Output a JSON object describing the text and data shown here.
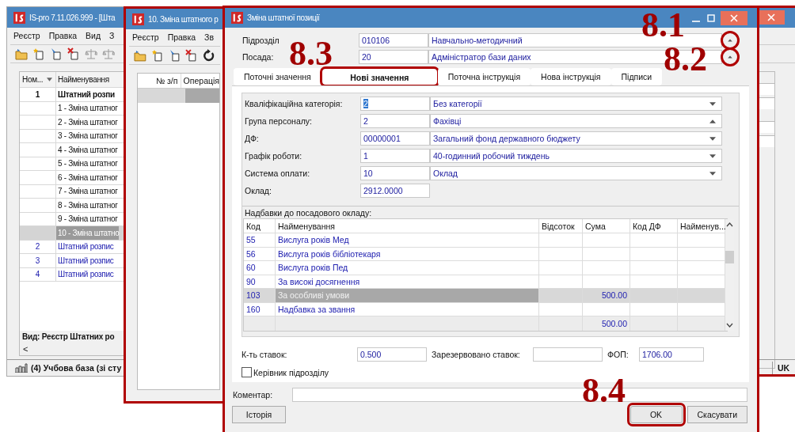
{
  "main_window": {
    "title": "IS-pro 7.11.026.999 - [Шта",
    "menu": [
      "Реєстр",
      "Правка",
      "Вид",
      "З"
    ],
    "toolbar": [
      {
        "kind": "folder"
      },
      {
        "kind": "new"
      },
      {
        "kind": "edit"
      },
      {
        "kind": "delete"
      },
      {
        "kind": "scales"
      },
      {
        "kind": "scales"
      }
    ],
    "table": {
      "columns": [
        "Ном...",
        "Найменування"
      ],
      "rows": [
        {
          "number": "1",
          "name": "Штатний розпи",
          "expanded": true,
          "children": [
            {
              "name": "1 - Зміна штатног",
              "selected": false
            },
            {
              "name": "2 - Зміна штатног",
              "selected": false
            },
            {
              "name": "3 - Зміна штатног",
              "selected": false
            },
            {
              "name": "4 - Зміна штатног",
              "selected": false
            },
            {
              "name": "5 - Зміна штатног",
              "selected": false
            },
            {
              "name": "6 - Зміна штатног",
              "selected": false
            },
            {
              "name": "7 - Зміна штатног",
              "selected": false
            },
            {
              "name": "8 - Зміна штатног",
              "selected": false
            },
            {
              "name": "9 - Зміна штатног",
              "selected": false
            },
            {
              "name": "10 - Зміна штатно",
              "selected": true
            }
          ]
        },
        {
          "number": "2",
          "name": "Штатний розпис",
          "expanded": false,
          "children": []
        },
        {
          "number": "3",
          "name": "Штатний розпис",
          "expanded": false,
          "children": []
        },
        {
          "number": "4",
          "name": "Штатний розпис",
          "expanded": false,
          "children": []
        }
      ]
    },
    "view_label": "Вид: Реєстр Штатних ро",
    "scroll_left": "<",
    "status_bar": {
      "database": "(4) Учбова база (зі сту",
      "language": "UK"
    }
  },
  "second_window": {
    "title": "10. Зміна штатного р",
    "menu": [
      "Реєстр",
      "Правка",
      "Зв"
    ],
    "toolbar": [
      {
        "kind": "folder"
      },
      {
        "kind": "new"
      },
      {
        "kind": "edit"
      },
      {
        "kind": "delete"
      },
      {
        "kind": "refresh"
      }
    ],
    "columns": [
      "№ з/п",
      "Операція"
    ]
  },
  "dialog": {
    "title": "Зміна штатної позиції",
    "header_fields": [
      {
        "label": "Підрозділ",
        "code": "010106",
        "value": "Навчально-методичний",
        "circled": true
      },
      {
        "label": "Посада:",
        "code": "20",
        "value": "Адміністратор бази даних",
        "circled": true
      }
    ],
    "tabs": [
      {
        "label": "Поточні значення",
        "selected": false,
        "highlighted": false
      },
      {
        "label": "Нові значення",
        "selected": true,
        "highlighted": true
      },
      {
        "label": "Поточна інструкція",
        "selected": false,
        "highlighted": false
      },
      {
        "label": "Нова інструкція",
        "selected": false,
        "highlighted": false
      },
      {
        "label": "Підписи",
        "selected": false,
        "highlighted": false
      }
    ],
    "fields": [
      {
        "label": "Кваліфікаційна категорія:",
        "code": "2",
        "value": "Без категорії",
        "kind": "combo",
        "expanded": false,
        "code_selected": true
      },
      {
        "label": "Група персоналу:",
        "code": "2",
        "value": "Фахівці",
        "kind": "combo",
        "expanded": true,
        "code_selected": false
      },
      {
        "label": "ДФ:",
        "code": "00000001",
        "value": "Загальний фонд державного бюджету",
        "kind": "combo",
        "expanded": false,
        "code_selected": false
      },
      {
        "label": "Графік роботи:",
        "code": "1",
        "value": "40-годинний робочий тиждень",
        "kind": "combo",
        "expanded": false,
        "code_selected": false
      },
      {
        "label": "Система оплати:",
        "code": "10",
        "value": "Оклад",
        "kind": "combo",
        "expanded": false,
        "code_selected": false
      },
      {
        "label": "Оклад:",
        "code": "2912.0000",
        "kind": "plain",
        "code_selected": false
      }
    ],
    "allowances": {
      "title": "Надбавки до посадового окладу:",
      "columns": [
        "Код",
        "Найменування",
        "Відсоток",
        "Сума",
        "Код ДФ",
        "Найменув..."
      ],
      "rows": [
        {
          "code": "55",
          "name": "Вислуга років Мед",
          "selected": false
        },
        {
          "code": "56",
          "name": "Вислуга років бібліотекаря",
          "selected": false
        },
        {
          "code": "60",
          "name": "Вислуга років Пед",
          "selected": false
        },
        {
          "code": "90",
          "name": "За високі досягнення",
          "selected": false
        },
        {
          "code": "103",
          "name": "За особливі умови",
          "sum": "500.00",
          "selected": true
        },
        {
          "code": "160",
          "name": "Надбавка за звання",
          "selected": false
        }
      ],
      "total": "500.00"
    },
    "rates_label": "К-ть ставок:",
    "rates": "0.500",
    "reserved_label": "Зарезервовано ставок:",
    "fop_label": "ФОП:",
    "fop": "1706.00",
    "head_of_unit": {
      "label": "Керівник підрозділу",
      "checked": false
    },
    "comment_label": "Коментар:",
    "buttons": [
      {
        "label": "Історія",
        "highlighted": false
      },
      {
        "label": "OK",
        "highlighted": true
      },
      {
        "label": "Скасувати",
        "highlighted": false
      }
    ]
  },
  "annotations": [
    "8.1",
    "8.2",
    "8.3",
    "8.4"
  ]
}
